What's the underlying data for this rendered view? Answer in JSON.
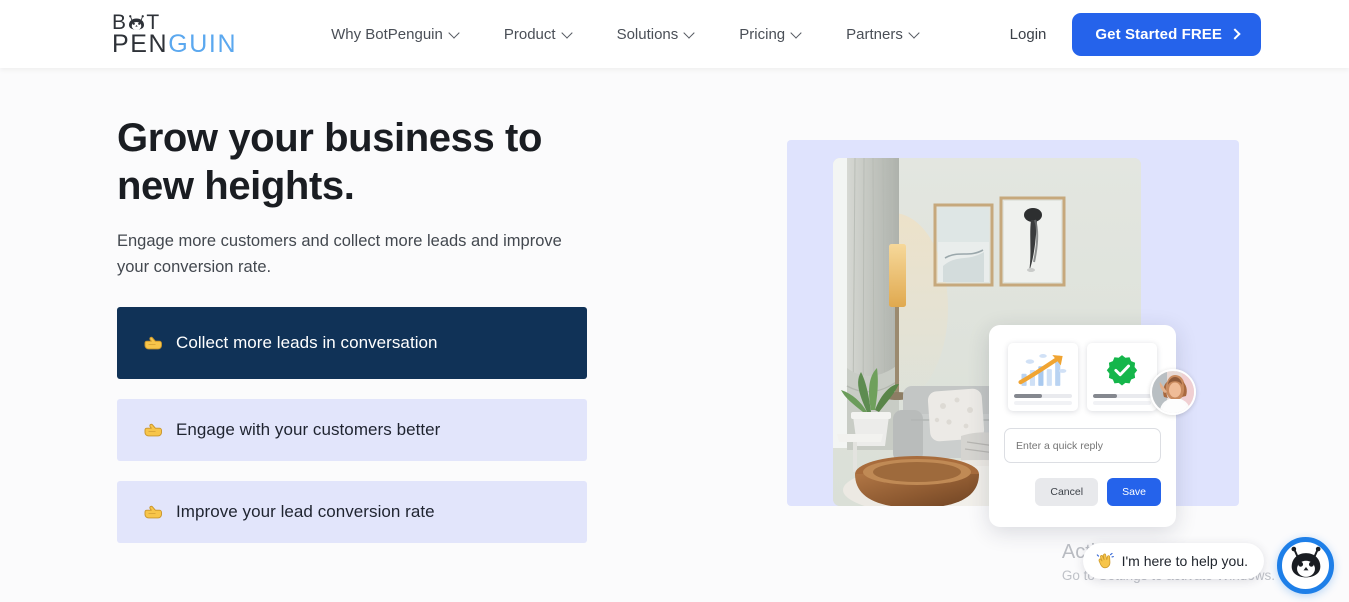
{
  "brand": {
    "logo_line1": "B",
    "logo_line1_end": "T",
    "logo_line2_dark": "PEN",
    "logo_line2_blue": "GUIN",
    "logo_icon": "penguin-icon",
    "accent_blue": "#2563eb",
    "logo_light_blue": "#5ba8ef"
  },
  "nav": {
    "items": [
      {
        "label": "Why BotPenguin",
        "has_dropdown": true
      },
      {
        "label": "Product",
        "has_dropdown": true
      },
      {
        "label": "Solutions",
        "has_dropdown": true
      },
      {
        "label": "Pricing",
        "has_dropdown": true
      },
      {
        "label": "Partners",
        "has_dropdown": true
      }
    ],
    "login_label": "Login",
    "cta_label": "Get Started FREE"
  },
  "hero": {
    "title_line1": "Grow your business to",
    "title_line2": "new heights.",
    "subtitle": "Engage more customers and collect more leads and improve your conversion rate.",
    "features": [
      {
        "emoji": "👉",
        "label": "Collect more leads in conversation",
        "active": true
      },
      {
        "emoji": "👉",
        "label": "Engage with your customers better",
        "active": false
      },
      {
        "emoji": "👉",
        "label": "Improve your lead conversion rate",
        "active": false
      }
    ]
  },
  "preview": {
    "panel_color": "#dfe3fd",
    "photo_alt": "living-room-photo",
    "mini_cards": [
      {
        "graphic": "growth-chart-icon"
      },
      {
        "graphic": "green-verified-check-icon"
      }
    ],
    "avatar_alt": "person-avatar",
    "quick_reply_placeholder": "Enter a quick reply",
    "quick_reply_value": "",
    "cancel_label": "Cancel",
    "save_label": "Save"
  },
  "watermark": {
    "title": "Activate Windows",
    "subtitle": "Go to Settings to activate Windows."
  },
  "chat": {
    "bubble_emoji": "👋",
    "bubble_text": "I'm here to help you.",
    "launcher_icon": "bot-penguin-avatar-icon"
  }
}
